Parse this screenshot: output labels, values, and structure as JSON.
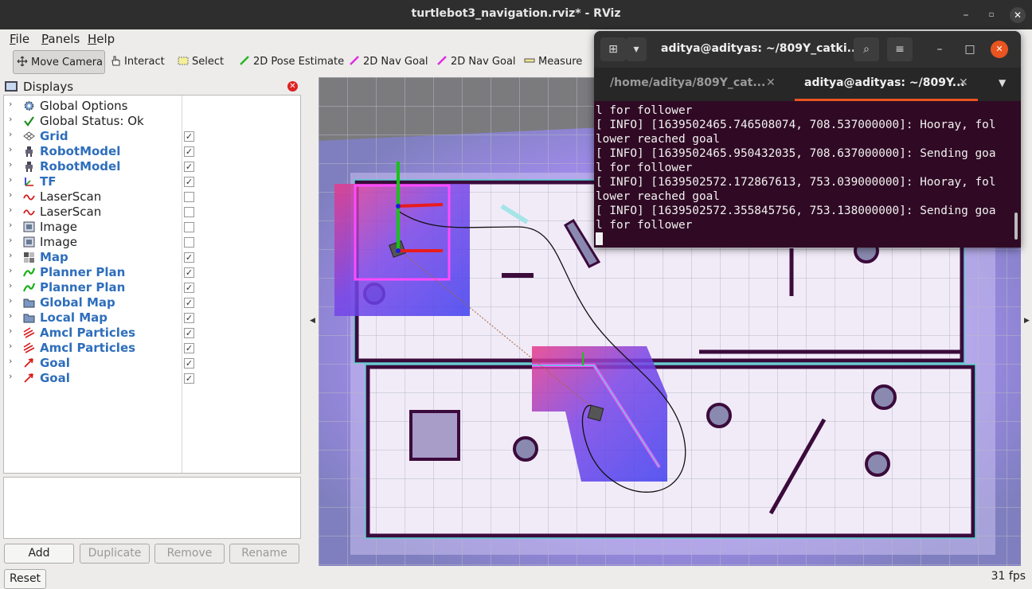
{
  "window": {
    "title": "turtlebot3_navigation.rviz* - RViz"
  },
  "menu": [
    {
      "label": "File",
      "key": "F",
      "rest": "ile"
    },
    {
      "label": "Panels",
      "key": "P",
      "rest": "anels"
    },
    {
      "label": "Help",
      "key": "H",
      "rest": "elp"
    }
  ],
  "toolbar": {
    "move_camera": "Move Camera",
    "interact": "Interact",
    "select": "Select",
    "pose_estimate": "2D Pose Estimate",
    "nav_goal_1": "2D Nav Goal",
    "nav_goal_2": "2D Nav Goal",
    "measure": "Measure"
  },
  "displays": {
    "title": "Displays",
    "items": [
      {
        "label": "Global Options",
        "icon": "gear-icon",
        "checkbox": null,
        "bold": false
      },
      {
        "label": "Global Status: Ok",
        "icon": "check-icon",
        "checkbox": null,
        "bold": false
      },
      {
        "label": "Grid",
        "icon": "grid-icon",
        "checkbox": true,
        "bold": true
      },
      {
        "label": "RobotModel",
        "icon": "robot-icon",
        "checkbox": true,
        "bold": true
      },
      {
        "label": "RobotModel",
        "icon": "robot-icon",
        "checkbox": true,
        "bold": true
      },
      {
        "label": "TF",
        "icon": "axes-icon",
        "checkbox": true,
        "bold": true
      },
      {
        "label": "LaserScan",
        "icon": "laser-icon",
        "checkbox": false,
        "bold": false
      },
      {
        "label": "LaserScan",
        "icon": "laser-icon",
        "checkbox": false,
        "bold": false
      },
      {
        "label": "Image",
        "icon": "image-icon",
        "checkbox": false,
        "bold": false
      },
      {
        "label": "Image",
        "icon": "image-icon",
        "checkbox": false,
        "bold": false
      },
      {
        "label": "Map",
        "icon": "map-icon",
        "checkbox": true,
        "bold": true
      },
      {
        "label": "Planner Plan",
        "icon": "path-icon",
        "checkbox": true,
        "bold": true
      },
      {
        "label": "Planner Plan",
        "icon": "path-icon",
        "checkbox": true,
        "bold": true
      },
      {
        "label": "Global Map",
        "icon": "folder-icon",
        "checkbox": true,
        "bold": true
      },
      {
        "label": "Local Map",
        "icon": "folder-icon",
        "checkbox": true,
        "bold": true
      },
      {
        "label": "Amcl Particles",
        "icon": "particles-icon",
        "checkbox": true,
        "bold": true
      },
      {
        "label": "Amcl Particles",
        "icon": "particles-icon",
        "checkbox": true,
        "bold": true
      },
      {
        "label": "Goal",
        "icon": "arrow-icon",
        "checkbox": true,
        "bold": true
      },
      {
        "label": "Goal",
        "icon": "arrow-icon",
        "checkbox": true,
        "bold": true
      }
    ],
    "buttons": {
      "add": "Add",
      "duplicate": "Duplicate",
      "remove": "Remove",
      "rename": "Rename"
    }
  },
  "reset_label": "Reset",
  "fps": "31 fps",
  "terminal": {
    "title": "aditya@adityas: ~/809Y_catki...",
    "tabs": [
      {
        "label": "/home/aditya/809Y_cat...",
        "active": false
      },
      {
        "label": "aditya@adityas: ~/809Y...",
        "active": true
      }
    ],
    "lines": [
      "l for follower",
      "[ INFO] [1639502465.746508074, 708.537000000]: Hooray, fol",
      "lower reached goal",
      "[ INFO] [1639502465.950432035, 708.637000000]: Sending goa",
      "l for follower",
      "[ INFO] [1639502572.172867613, 753.039000000]: Hooray, fol",
      "lower reached goal",
      "[ INFO] [1639502572.355845756, 753.138000000]: Sending goa",
      "l for follower"
    ]
  },
  "colors": {
    "terminal_bg": "#300a24",
    "titlebar_bg": "#2e2e2e",
    "display_name_blue": "#2e6ebc",
    "tab_underline": "#e95420",
    "close_button": "#e95420"
  }
}
